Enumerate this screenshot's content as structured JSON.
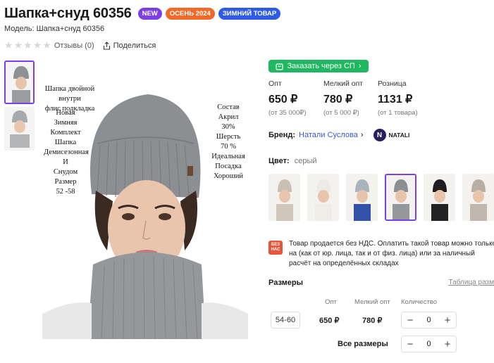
{
  "product": {
    "title": "Шапка+снуд 60356",
    "badges": [
      {
        "text": "NEW",
        "color": "#7b3fe4"
      },
      {
        "text": "ОСЕНЬ 2024",
        "color": "#f06a2a"
      },
      {
        "text": "ЗИМНИЙ ТОВАР",
        "color": "#2d5be3"
      }
    ],
    "model_label": "Модель: Шапка+снуд 60356",
    "reviews": "Отзывы (0)",
    "share": "Поделиться",
    "rating": 0
  },
  "image_text": {
    "top": [
      "Шапка двойной внутри",
      "флис подкладка"
    ],
    "left": [
      "Новая",
      "Зимняя",
      "Комплект",
      "Шапка",
      "Демисезонная",
      "И",
      "Снудом",
      "Размер",
      "52 -58"
    ],
    "right": [
      "Состав",
      "Акрил",
      "30%",
      "Шерсть",
      "70 %",
      "Идеальная",
      "Посадка",
      "Хороший"
    ]
  },
  "order_button": "Заказать через СП",
  "prices": [
    {
      "label": "Опт",
      "value": "650 ₽",
      "min": "(от 35 000₽)"
    },
    {
      "label": "Мелкий опт",
      "value": "780 ₽",
      "min": "(от 5 000 ₽)"
    },
    {
      "label": "Розница",
      "value": "1131 ₽",
      "min": "(от 1 товара)"
    }
  ],
  "brand": {
    "label": "Бренд:",
    "name": "Натали Суслова",
    "logo_letter": "N",
    "logo_text": "NATALI"
  },
  "color": {
    "label": "Цвет:",
    "value": "серый"
  },
  "vat": {
    "icon_line1": "БЕЗ",
    "icon_line2": "НАС",
    "text": "Товар продается без НДС. Оплатить такой товар можно только на (как от юр. лица, так и от физ. лица) или за наличный расчёт на определённых складах"
  },
  "sizes": {
    "title": "Размеры",
    "table_link": "Таблица разм",
    "headers": {
      "opt": "Опт",
      "small_opt": "Мелкий опт",
      "qty": "Количество"
    },
    "row": {
      "size": "54-60",
      "opt": "650 ₽",
      "small_opt": "780 ₽",
      "qty": "0"
    },
    "all": {
      "label": "Все размеры",
      "qty": "0"
    }
  }
}
